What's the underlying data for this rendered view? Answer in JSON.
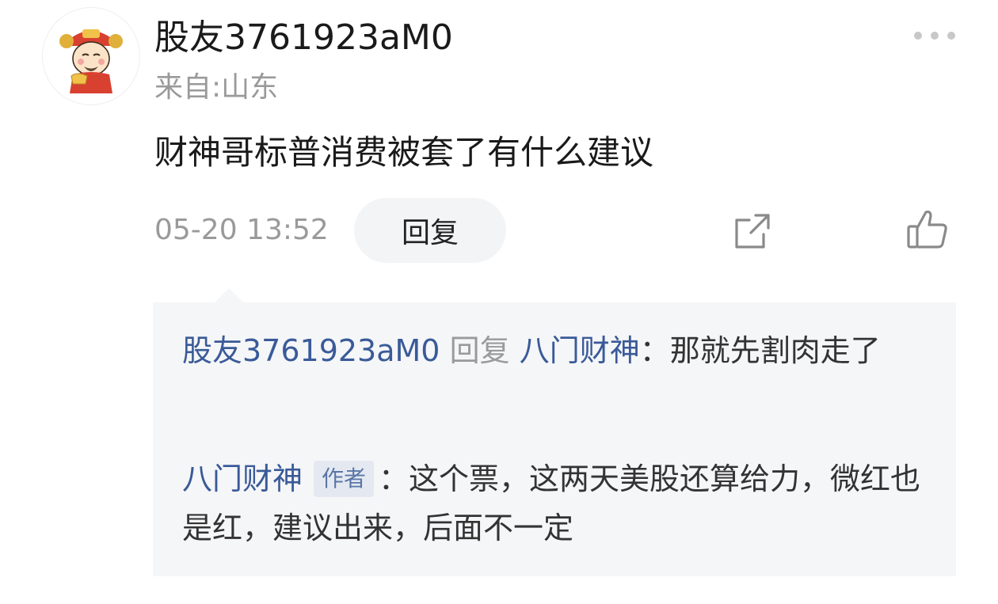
{
  "post": {
    "username": "股友3761923aM0",
    "location": "来自:山东",
    "text": "财神哥标普消费被套了有什么建议",
    "timestamp": "05-20 13:52",
    "reply_label": "回复"
  },
  "icons": {
    "avatar": "caishen-avatar",
    "more": "more-icon",
    "share": "share-icon",
    "like": "like-icon"
  },
  "replies": [
    {
      "from": "股友3761923aM0",
      "action": "回复",
      "to": "八门财神",
      "separator": "：",
      "text": "那就先割肉走了"
    },
    {
      "from": "八门财神",
      "badge": "作者",
      "separator": "：",
      "text": "这个票，这两天美股还算给力，微红也是红，建议出来，后面不一定"
    }
  ],
  "colors": {
    "link": "#3a5a98",
    "muted": "#9a9a9a",
    "reply_bg": "#f5f6f8"
  }
}
